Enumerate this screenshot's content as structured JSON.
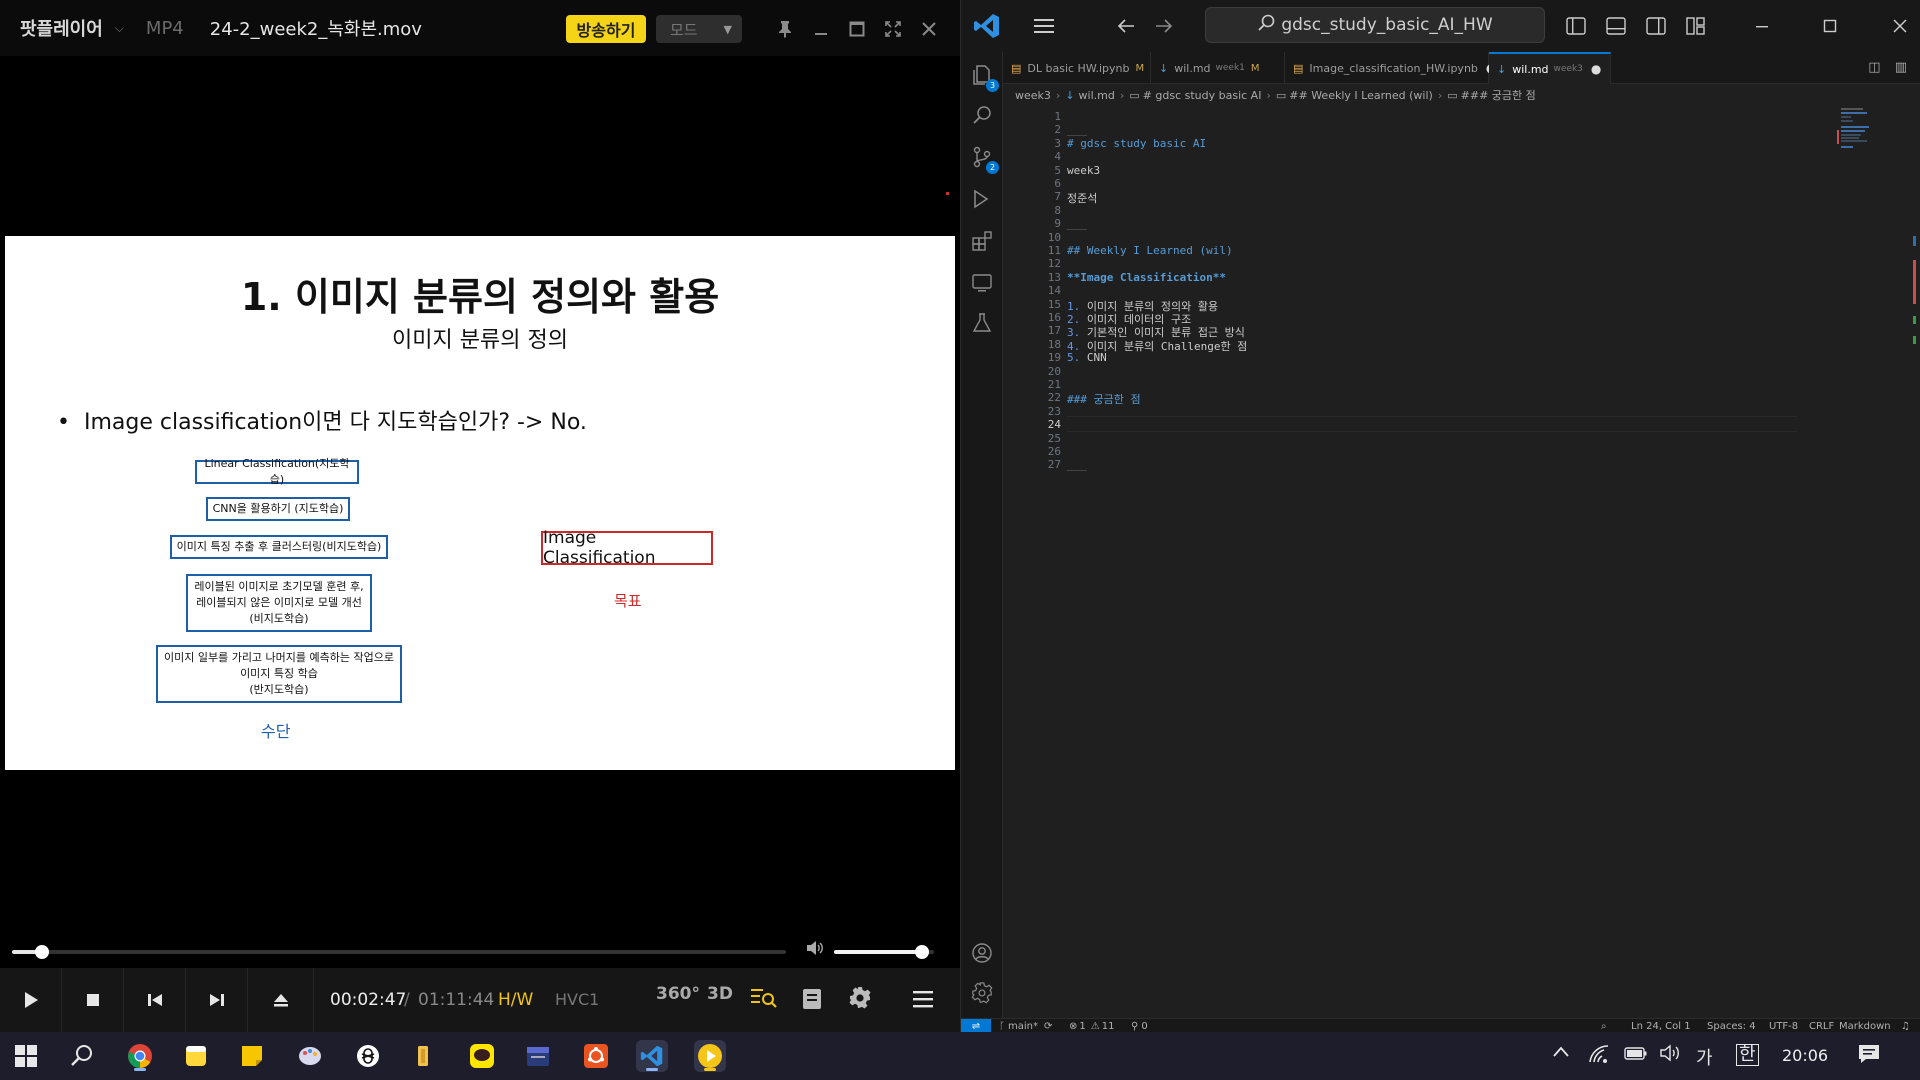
{
  "player": {
    "app_name": "팟플레이어",
    "format": "MP4",
    "filename": "24-2_week2_녹화본.mov",
    "broadcast_label": "방송하기",
    "mode_label": "모드",
    "slide": {
      "title": "1. 이미지 분류의 정의와 활용",
      "subtitle": "이미지 분류의 정의",
      "bullet": "Image classification이면 다 지도학습인가? -> No.",
      "means_boxes": [
        "Linear Classification(지도학습)",
        "CNN을 활용하기 (지도학습)",
        "이미지 특징 추출 후 클러스터링(비지도학습)",
        "레이블된 이미지로 초기모델 훈련 후,\n레이블되지 않은 이미지로 모델 개선\n(비지도학습)",
        "이미지 일부를 가리고 나머지를 예측하는 작업으로\n이미지 특징 학습\n(반지도학습)"
      ],
      "goal_box": "Image Classification",
      "means_label": "수단",
      "goal_label": "목표"
    },
    "seek_fraction": 0.039,
    "volume_fraction": 0.88,
    "time_current": "00:02:47",
    "time_separator": "/",
    "time_total": "01:11:44",
    "hw_label": "H/W",
    "codec_label": "HVC1",
    "btn_360": "360°",
    "btn_3d": "3D"
  },
  "vscode": {
    "search_text": "gdsc_study_basic_AI_HW",
    "tabs": [
      {
        "name": "DL basic HW.ipynb",
        "sub": "",
        "mod": "M",
        "icon": "notebook-icon",
        "active": false
      },
      {
        "name": "wil.md",
        "sub": "week1",
        "mod": "M",
        "icon": "markdown-icon",
        "active": false
      },
      {
        "name": "Image_classification_HW.ipynb",
        "sub": "",
        "mod": "●",
        "icon": "notebook-icon",
        "active": false
      },
      {
        "name": "wil.md",
        "sub": "week3",
        "mod": "●",
        "icon": "markdown-icon",
        "active": true
      }
    ],
    "breadcrumb": [
      "week3",
      "wil.md",
      "# gdsc study basic AI",
      "## Weekly I Learned (wil)",
      "### 궁금한 점"
    ],
    "lines": [
      "",
      "___",
      "# gdsc study basic AI",
      "",
      "week3",
      "",
      "정준석",
      "",
      "___",
      "",
      "## Weekly I Learned (wil)",
      "",
      "**Image Classification**",
      "",
      "1. 이미지 분류의 정의와 활용",
      "2. 이미지 데이터의 구조",
      "3. 기본적인 이미지 분류 접근 방식",
      "4. 이미지 분류의 Challenge한 점",
      "5. CNN",
      "",
      "",
      "### 궁금한 점",
      "",
      "",
      "",
      "",
      "___"
    ],
    "current_line": 24,
    "status": {
      "branch": "main*",
      "errors": "1",
      "warnings": "11",
      "ports": "0",
      "position": "Ln 24, Col 1",
      "spaces": "Spaces: 4",
      "encoding": "UTF-8",
      "eol": "CRLF",
      "language": "Markdown"
    },
    "activity_badges": {
      "explorer": "3",
      "source_control": "2"
    }
  },
  "taskbar": {
    "ime_mode": "가",
    "ime_lang": "한",
    "clock": "20:06"
  },
  "colors": {
    "broadcast_yellow": "#f5d418",
    "hw_yellow": "#f0c419",
    "vscode_blue": "#0078d4",
    "slide_blue": "#1f5fa8",
    "slide_red": "#cc2a2a"
  }
}
